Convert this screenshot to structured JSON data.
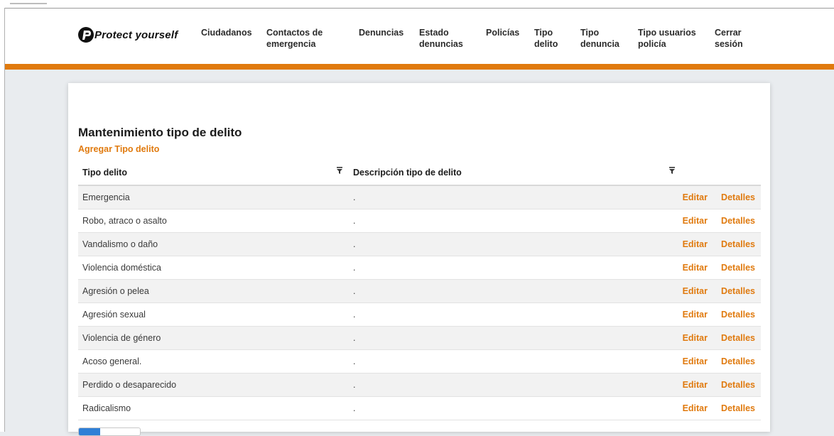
{
  "brand": {
    "name": "Protect yourself",
    "icon": "shield-p-icon"
  },
  "nav": {
    "ciudadanos": "Ciudadanos",
    "contactos_1": "Contactos de",
    "contactos_2": "emergencia",
    "denuncias": "Denuncias",
    "estado_1": "Estado",
    "estado_2": "denuncias",
    "policias": "Policías",
    "tipo_delito_1": "Tipo",
    "tipo_delito_2": "delito",
    "tipo_denuncia_1": "Tipo",
    "tipo_denuncia_2": "denuncia",
    "tipo_usuarios_1": "Tipo usuarios",
    "tipo_usuarios_2": "policía",
    "cerrar_1": "Cerrar",
    "cerrar_2": "sesión"
  },
  "page": {
    "title": "Mantenimiento tipo de delito",
    "add_link": "Agregar Tipo delito"
  },
  "table": {
    "headers": [
      "Tipo delito",
      "Descripción tipo de delito"
    ],
    "filter_icon": "filter-icon",
    "edit_label": "Editar",
    "details_label": "Detalles",
    "rows": [
      {
        "name": "Emergencia",
        "desc": "."
      },
      {
        "name": "Robo, atraco o asalto",
        "desc": "."
      },
      {
        "name": "Vandalismo o daño",
        "desc": "."
      },
      {
        "name": "Violencia doméstica",
        "desc": "."
      },
      {
        "name": "Agresión o pelea",
        "desc": "."
      },
      {
        "name": "Agresión sexual",
        "desc": "."
      },
      {
        "name": "Violencia de género",
        "desc": "."
      },
      {
        "name": "Acoso general.",
        "desc": "."
      },
      {
        "name": "Perdido o desaparecido",
        "desc": "."
      },
      {
        "name": "Radicalismo",
        "desc": "."
      }
    ]
  },
  "colors": {
    "accent": "#e07a0e",
    "row_alt": "#f2f2f2",
    "pager_active": "#2f7fd6"
  }
}
